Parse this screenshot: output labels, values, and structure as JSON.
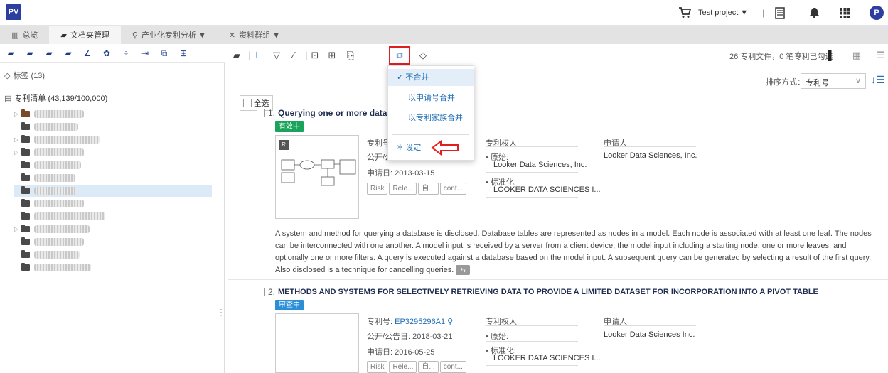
{
  "app": {
    "logo": "PV"
  },
  "topbar": {
    "project": "Test project ▼",
    "avatar": "P"
  },
  "tabs": [
    {
      "label": "总览",
      "icon": "▥"
    },
    {
      "label": "文档夹管理",
      "icon": "▰"
    },
    {
      "label": "产业化专利分析 ▼",
      "icon": "⚲"
    },
    {
      "label": "资料群组 ▼",
      "icon": "✕"
    }
  ],
  "left": {
    "tags": "标签 (13)",
    "patent_list": "专利清单 (43,139/100,000)"
  },
  "main": {
    "select_all": "全选",
    "summary": "26 专利文件，0 笔专利已勾选",
    "sort_label": "排序方式：",
    "sort_value": "专利号"
  },
  "dropdown": {
    "items": [
      "不合并",
      "以申请号合并",
      "以专利家族合并",
      "设定"
    ],
    "check": "✓"
  },
  "results": [
    {
      "index": "1.",
      "title": "Querying one or more databas",
      "status": "有效中",
      "status_color": "#1aa35a",
      "thumb_label": "R",
      "number_label": "专利号:",
      "pubdate_label": "公开/公",
      "appdate": "申请日: 2013-03-15",
      "owner_label": "专利权人:",
      "orig_label": "• 原始:",
      "orig_value": "Looker Data Sciences, Inc.",
      "std_label": "• 标准化:",
      "std_value": "LOOKER DATA SCIENCES I...",
      "applicant_label": "申请人:",
      "applicant_value": "Looker Data Sciences, Inc.",
      "buttons": [
        "Risk",
        "Rele...",
        "自...",
        "cont..."
      ],
      "abstract": "A system and method for querying a database is disclosed. Database tables are represented as nodes in a model. Each node is associated with at least one leaf. The nodes can be interconnected with one another. A model input is received by a server from a client device, the model input including a starting node, one or more leaves, and optionally one or more filters. A query is executed against a database based on the model input. A subsequent query can be generated by selecting a result of the first query. Also disclosed is a technique for cancelling queries."
    },
    {
      "index": "2.",
      "title": "METHODS AND SYSTEMS FOR SELECTIVELY RETRIEVING DATA TO PROVIDE A LIMITED DATASET FOR INCORPORATION INTO A PIVOT TABLE",
      "status": "审查中",
      "status_color": "#2b8fd8",
      "number_label": "专利号:",
      "number_value": "EP3295296A1",
      "pubdate": "公开/公告日: 2018-03-21",
      "appdate": "申请日: 2016-05-25",
      "owner_label": "专利权人:",
      "orig_label": "• 原始:",
      "std_label": "• 标准化:",
      "std_value": "LOOKER DATA SCIENCES I...",
      "applicant_label": "申请人:",
      "applicant_value": "Looker Data Sciences Inc.",
      "buttons": [
        "Risk",
        "Rele...",
        "自...",
        "cont..."
      ]
    }
  ]
}
